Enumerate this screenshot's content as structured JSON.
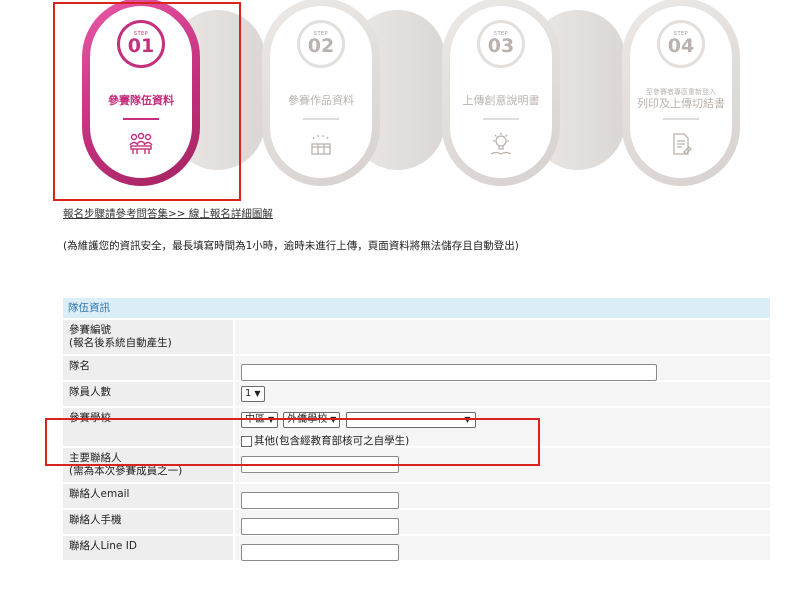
{
  "steps": [
    {
      "tag": "STEP",
      "num": "01",
      "label": "參賽隊伍資料",
      "state": "active",
      "icon": "team-meeting-icon"
    },
    {
      "tag": "STEP",
      "num": "02",
      "label": "參賽作品資料",
      "state": "inactive",
      "icon": "sparkle-blocks-icon"
    },
    {
      "tag": "STEP",
      "num": "03",
      "label": "上傳創意說明書",
      "state": "inactive",
      "icon": "lightbulb-book-icon"
    },
    {
      "tag": "STEP",
      "num": "04",
      "label_small": "至參賽者專區重新登入",
      "label": "列印及上傳切結書",
      "state": "inactive",
      "icon": "document-edit-icon"
    }
  ],
  "links": {
    "hint": "報名步驟請參考問答集>> 線上報名詳細圖解"
  },
  "notice": "(為維護您的資訊安全，最長填寫時間為1小時，逾時未進行上傳，頁面資料將無法儲存且自動登出)",
  "form": {
    "section_title": "隊伍資訊",
    "rows": {
      "entry_no": {
        "label1": "參賽編號",
        "label2": "(報名後系統自動產生)"
      },
      "team_name": {
        "label": "隊名",
        "value": ""
      },
      "member_count": {
        "label": "隊員人數",
        "value": "1"
      },
      "school": {
        "label": "參賽學校",
        "region": "中區",
        "type": "外僑學校",
        "school": "--",
        "other_label": "其他(包含經教育部核可之自學生)"
      },
      "contact": {
        "label1": "主要聯絡人",
        "label2": "(需為本次參賽成員之一)",
        "value": ""
      },
      "email": {
        "label": "聯絡人email",
        "value": ""
      },
      "phone": {
        "label": "聯絡人手機",
        "value": ""
      },
      "line": {
        "label": "聯絡人Line ID",
        "value": ""
      }
    }
  },
  "colors": {
    "accent": "#c4307d",
    "highlight": "#d9231f",
    "section_bg": "#dbeef8",
    "section_text": "#2f78b0"
  }
}
